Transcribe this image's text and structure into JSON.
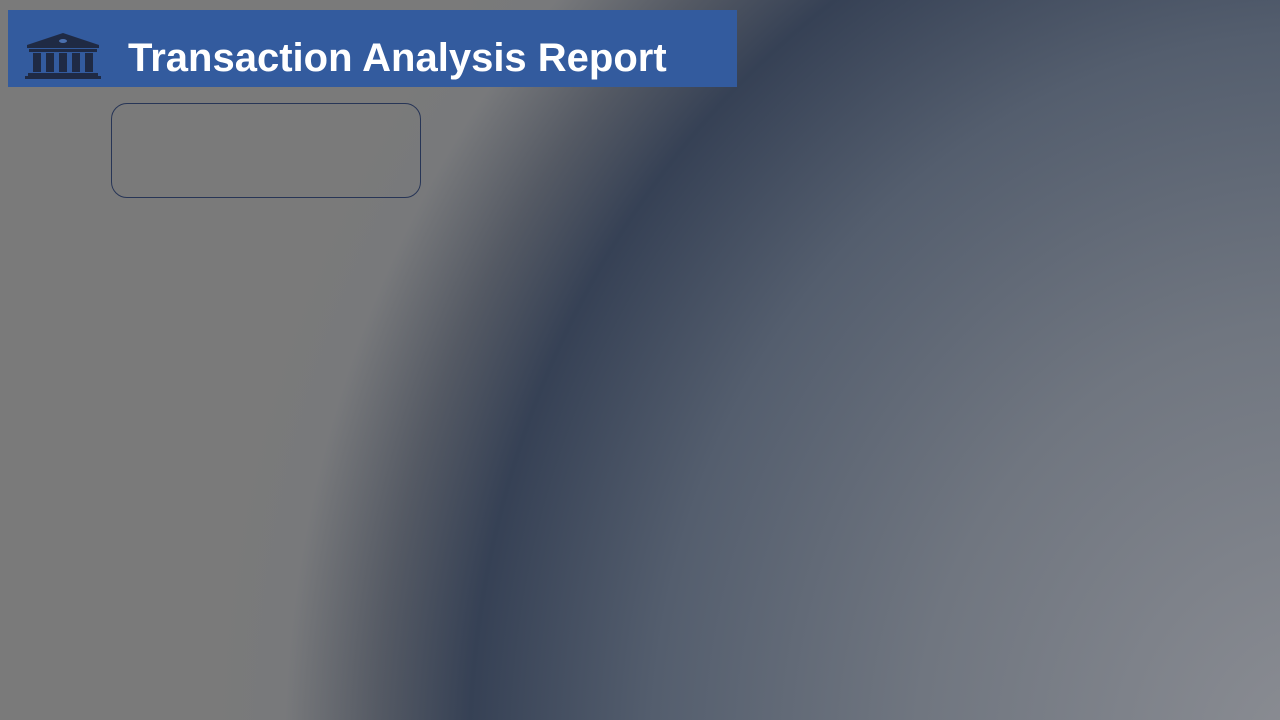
{
  "header": {
    "title": "Transaction Analysis Report",
    "icon": "bank-icon",
    "banner_color": "#335b9e",
    "icon_color": "#1f2a44"
  },
  "content_box": {
    "text": ""
  }
}
